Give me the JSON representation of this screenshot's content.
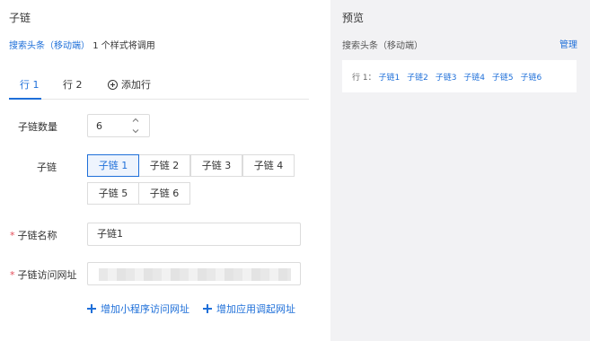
{
  "left": {
    "title": "子链",
    "call_info": {
      "link": "搜索头条（移动端）",
      "rest": "1 个样式将调用"
    },
    "tabs": [
      "行 1",
      "行 2"
    ],
    "add_row_label": "添加行",
    "count": {
      "label": "子链数量",
      "value": "6"
    },
    "sublinks": {
      "label": "子链",
      "chips": [
        "子链 1",
        "子链 2",
        "子链 3",
        "子链 4",
        "子链 5",
        "子链 6"
      ],
      "selected": "子链 1"
    },
    "name_field": {
      "required_mark": "*",
      "label": "子链名称",
      "value": "子链1"
    },
    "url_field": {
      "required_mark": "*",
      "label": "子链访问网址"
    },
    "actions": {
      "add_miniprogram_url": "增加小程序访问网址",
      "add_app_url": "增加应用调起网址"
    }
  },
  "right": {
    "title": "预览",
    "subtitle": "搜索头条（移动端）",
    "manage_label": "管理",
    "preview_row_label": "行 1：",
    "preview_links": [
      "子链1",
      "子链2",
      "子链3",
      "子链4",
      "子链5",
      "子链6"
    ]
  },
  "colors": {
    "accent": "#1e6fd9",
    "required": "#e34d59",
    "panel_bg": "#f2f2f4"
  },
  "icons": [
    "circle-plus-icon",
    "chevron-up-icon",
    "chevron-down-icon",
    "plus-icon"
  ]
}
